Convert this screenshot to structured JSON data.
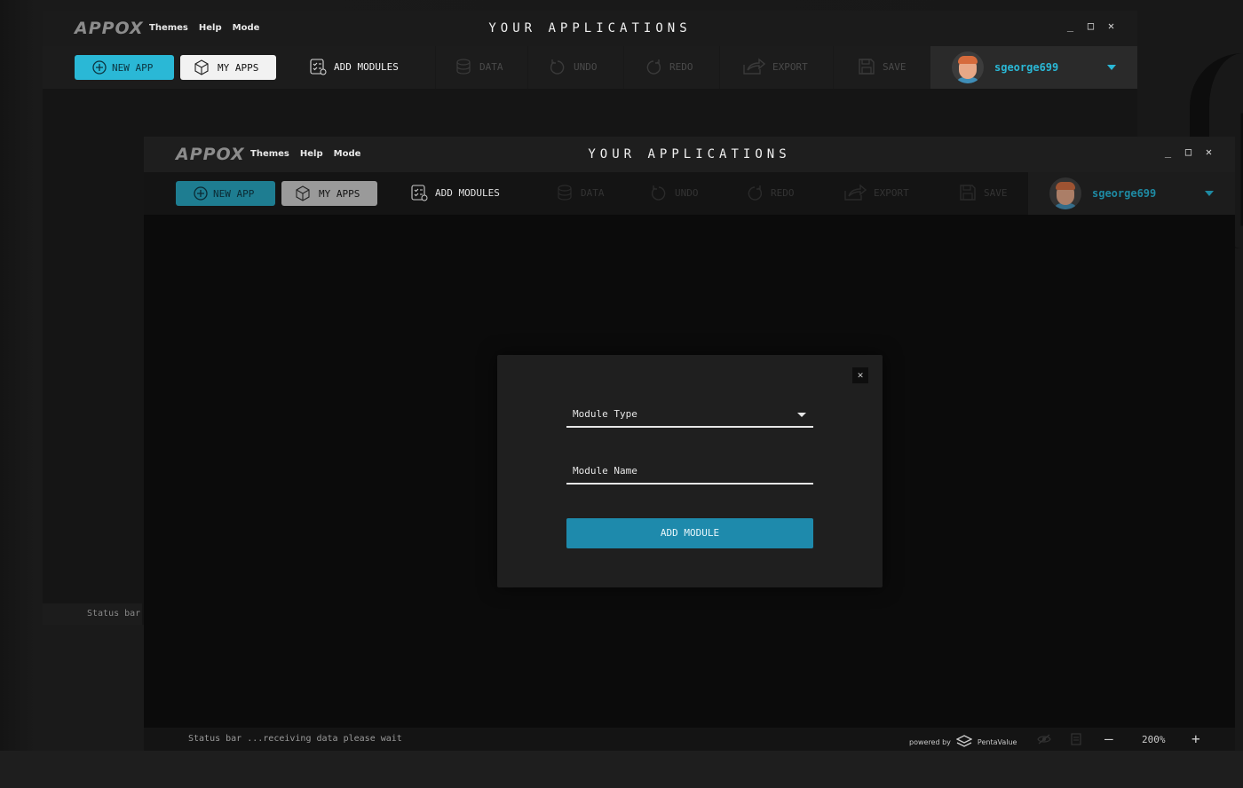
{
  "app": {
    "logo": "APPOX",
    "title": "YOUR APPLICATIONS",
    "menu": [
      "Themes",
      "Help",
      "Mode"
    ],
    "window_controls": {
      "minimize": "_",
      "maximize": "□",
      "close": "✕"
    }
  },
  "toolbar": {
    "new_app": "NEW APP",
    "my_apps": "MY APPS",
    "add_modules": "ADD MODULES",
    "data": "DATA",
    "undo": "UNDO",
    "redo": "REDO",
    "export": "EXPORT",
    "save": "SAVE"
  },
  "user": {
    "name": "sgeorge699"
  },
  "back_window": {
    "status": "Status bar"
  },
  "statusbar": {
    "text": "Status bar ...receiving data please wait",
    "powered_by": "powered by",
    "brand": "PentaValue",
    "zoom": "200%",
    "zoom_out": "—",
    "zoom_in": "+"
  },
  "modal": {
    "close": "✕",
    "module_type_label": "Module Type",
    "module_name_label": "Module Name",
    "submit": "ADD MODULE"
  },
  "colors": {
    "accent": "#2ab8d6",
    "button_primary": "#1e8aac",
    "background": "#161616"
  }
}
